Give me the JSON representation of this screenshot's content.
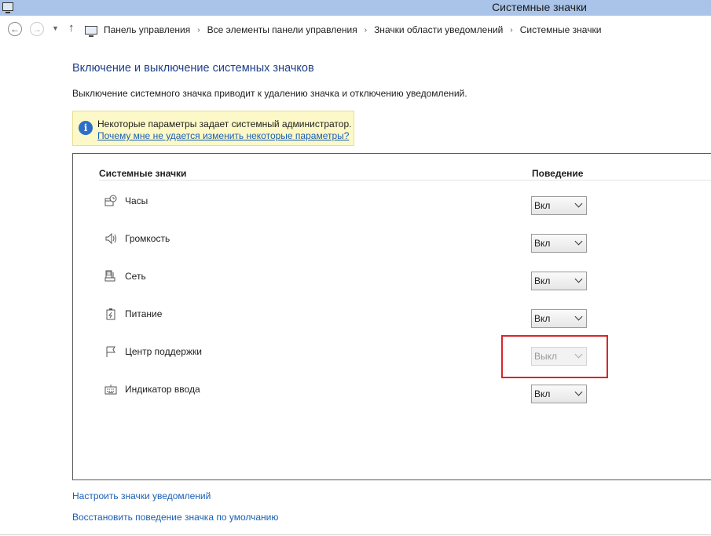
{
  "window": {
    "title": "Системные значки"
  },
  "nav": {
    "back_glyph": "←",
    "forward_glyph": "→",
    "dropdown_glyph": "▼",
    "up_glyph": "↑",
    "breadcrumbs": [
      "Панель управления",
      "Все элементы панели управления",
      "Значки области уведомлений",
      "Системные значки"
    ],
    "separator": "›"
  },
  "page": {
    "heading": "Включение и выключение системных значков",
    "description": "Выключение системного значка приводит к удалению значка и отключению уведомлений."
  },
  "info": {
    "icon": "info-icon",
    "icon_glyph": "i",
    "message": "Некоторые параметры задает системный администратор.",
    "link": "Почему мне не удается изменить некоторые параметры?"
  },
  "table": {
    "col_icons": "Системные значки",
    "col_behavior": "Поведение",
    "rows": [
      {
        "label": "Часы",
        "icon": "clock-icon",
        "value": "Вкл",
        "disabled": false
      },
      {
        "label": "Громкость",
        "icon": "volume-icon",
        "value": "Вкл",
        "disabled": false
      },
      {
        "label": "Сеть",
        "icon": "network-icon",
        "value": "Вкл",
        "disabled": false
      },
      {
        "label": "Питание",
        "icon": "power-icon",
        "value": "Вкл",
        "disabled": false
      },
      {
        "label": "Центр поддержки",
        "icon": "flag-icon",
        "value": "Выкл",
        "disabled": true
      },
      {
        "label": "Индикатор ввода",
        "icon": "keyboard-icon",
        "value": "Вкл",
        "disabled": false
      }
    ]
  },
  "links": {
    "configure": "Настроить значки уведомлений",
    "restore": "Восстановить поведение значка по умолчанию"
  },
  "colors": {
    "titlebar": "#a9c4e8",
    "heading": "#1e3f8a",
    "link": "#1a5fb4",
    "info_bg": "#fcf8c7",
    "highlight": "#d9252a"
  }
}
